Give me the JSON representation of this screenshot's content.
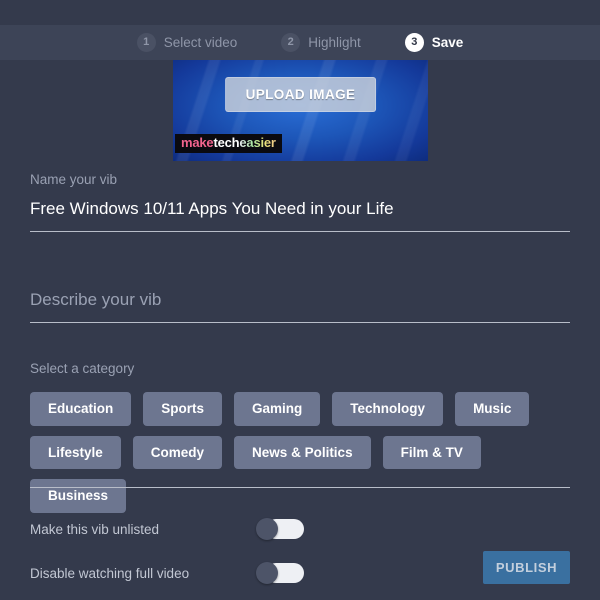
{
  "theme": {
    "page_bg": "#343a4c",
    "stepbar_bg": "#3d4457",
    "muted_text": "#9aa1b3",
    "chip_bg": "#6d7690",
    "publish_bg": "#3a70a0",
    "divider": "#b8bdc9"
  },
  "steps": [
    {
      "number": "1",
      "label": "Select video",
      "active": false
    },
    {
      "number": "2",
      "label": "Highlight",
      "active": false
    },
    {
      "number": "3",
      "label": "Save",
      "active": true
    }
  ],
  "thumbnail": {
    "upload_button_label": "UPLOAD IMAGE",
    "watermark": {
      "part1": "make",
      "part2": "tech",
      "part3": "easier"
    }
  },
  "form": {
    "name_field": {
      "label": "Name your vib",
      "value": "Free Windows 10/11 Apps You Need in your Life"
    },
    "description_field": {
      "placeholder": "Describe your vib",
      "value": ""
    },
    "category": {
      "label": "Select a category",
      "options": [
        "Education",
        "Sports",
        "Gaming",
        "Technology",
        "Music",
        "Lifestyle",
        "Comedy",
        "News & Politics",
        "Film & TV",
        "Business"
      ]
    }
  },
  "toggles": [
    {
      "label": "Make this vib unlisted",
      "state": "off"
    },
    {
      "label": "Disable watching full video",
      "state": "off"
    }
  ],
  "actions": {
    "publish_label": "PUBLISH"
  }
}
